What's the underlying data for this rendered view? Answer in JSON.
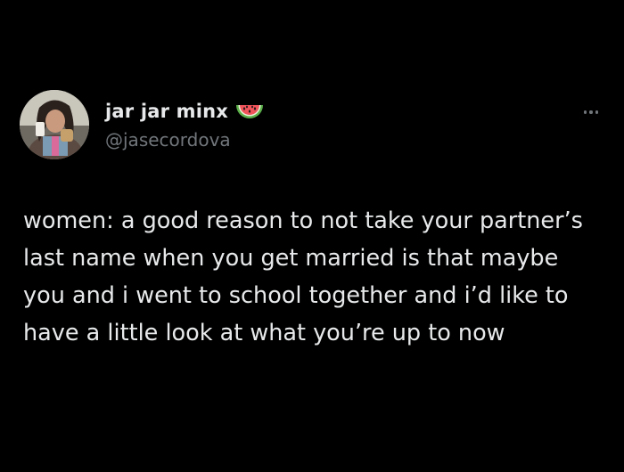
{
  "author": {
    "display_name": "jar jar minx",
    "handle": "@jasecordova",
    "emoji_icon": "watermelon-icon"
  },
  "menu": {
    "icon": "more-options-icon"
  },
  "tweet": {
    "text": "women: a good reason to not take your partner’s\nlast name when you get married is that maybe\nyou and i went to school together and i’d like to\nhave a little look at what you’re up to now"
  },
  "colors": {
    "background": "#000000",
    "primary_text": "#e7e9ea",
    "secondary_text": "#71767b"
  }
}
